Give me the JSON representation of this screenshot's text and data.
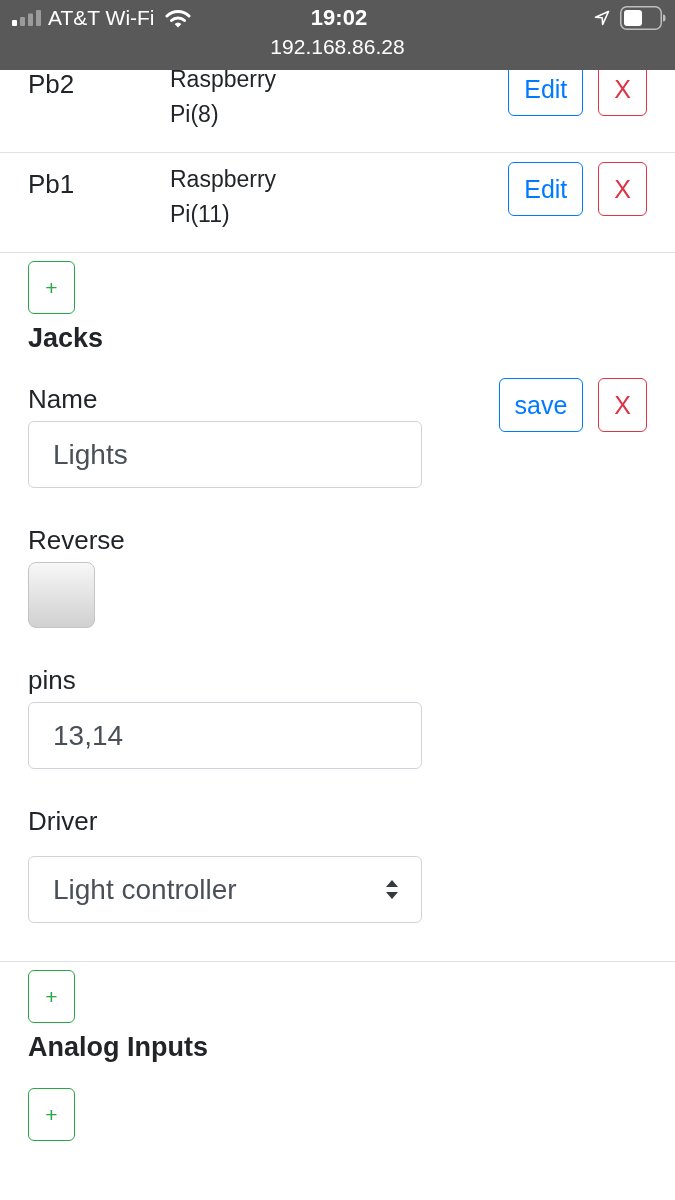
{
  "status_bar": {
    "carrier": "AT&T Wi-Fi",
    "time": "19:02",
    "url": "192.168.86.28"
  },
  "sections": [
    {
      "items": [
        {
          "kind": "display",
          "name": "Pb2",
          "board": "Raspberry Pi(8)",
          "buttons": [
            {
              "kind": "edit",
              "label": "Edit"
            },
            {
              "kind": "delete",
              "label": "X"
            }
          ]
        },
        {
          "kind": "display",
          "name": "Pb1",
          "board": "Raspberry Pi(11)",
          "buttons": [
            {
              "kind": "edit",
              "label": "Edit"
            },
            {
              "kind": "delete",
              "label": "X"
            }
          ]
        }
      ],
      "add_button": {
        "kind": "add",
        "label": "+"
      }
    },
    {
      "title": "Jacks",
      "items": [
        {
          "kind": "edit",
          "fields": [
            {
              "kind": "text",
              "label": "Name",
              "value": "Lights"
            },
            {
              "kind": "checkbox",
              "label": "Reverse",
              "checked": false
            },
            {
              "kind": "text",
              "label": "pins",
              "value": "13,14"
            },
            {
              "kind": "select",
              "label": "Driver",
              "value": "Light controller"
            }
          ],
          "buttons": [
            {
              "kind": "save",
              "label": "save"
            },
            {
              "kind": "delete",
              "label": "X"
            }
          ]
        }
      ],
      "add_button": {
        "kind": "add",
        "label": "+"
      }
    },
    {
      "title": "Analog Inputs",
      "add_button": {
        "kind": "add",
        "label": "+"
      }
    }
  ]
}
